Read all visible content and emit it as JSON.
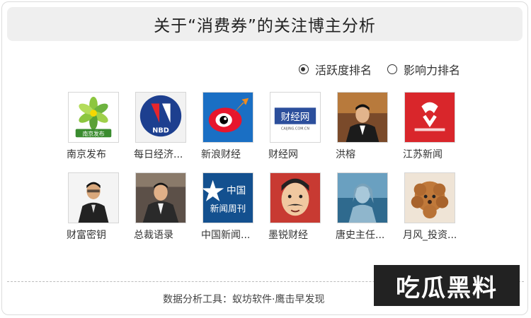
{
  "header": {
    "title": "关于“消费券”的关注博主分析"
  },
  "sort": {
    "options": [
      {
        "label": "活跃度排名",
        "checked": true
      },
      {
        "label": "影响力排名",
        "checked": false
      }
    ]
  },
  "bloggers": [
    {
      "name": "南京发布",
      "icon": "nanjing-fabu-logo"
    },
    {
      "name": "每日经济...",
      "icon": "nbd-logo"
    },
    {
      "name": "新浪财经",
      "icon": "sina-finance-logo"
    },
    {
      "name": "财经网",
      "icon": "caijing-logo"
    },
    {
      "name": "洪榕",
      "icon": "person-avatar"
    },
    {
      "name": "江苏新闻",
      "icon": "jiangsu-news-logo"
    },
    {
      "name": "财富密钥",
      "icon": "person-avatar"
    },
    {
      "name": "总裁语录",
      "icon": "person-avatar"
    },
    {
      "name": "中国新闻...",
      "icon": "china-news-weekly-logo"
    },
    {
      "name": "墨锐财经",
      "icon": "cartoon-avatar"
    },
    {
      "name": "唐史主任...",
      "icon": "statue-avatar"
    },
    {
      "name": "月风_投资...",
      "icon": "dog-avatar"
    }
  ],
  "logo_text": {
    "nanjing": "南京发布",
    "nbd": "NBD",
    "caijing": "财经网",
    "caijing_sub": "CAIJING.COM.CN",
    "chinanews_cn": "中国",
    "chinanews_weekly": "新闻周刊"
  },
  "footer": {
    "text": "数据分析工具：蚁坊软件·鹰击早发现"
  },
  "watermark": {
    "text": "吃瓜黑料"
  }
}
